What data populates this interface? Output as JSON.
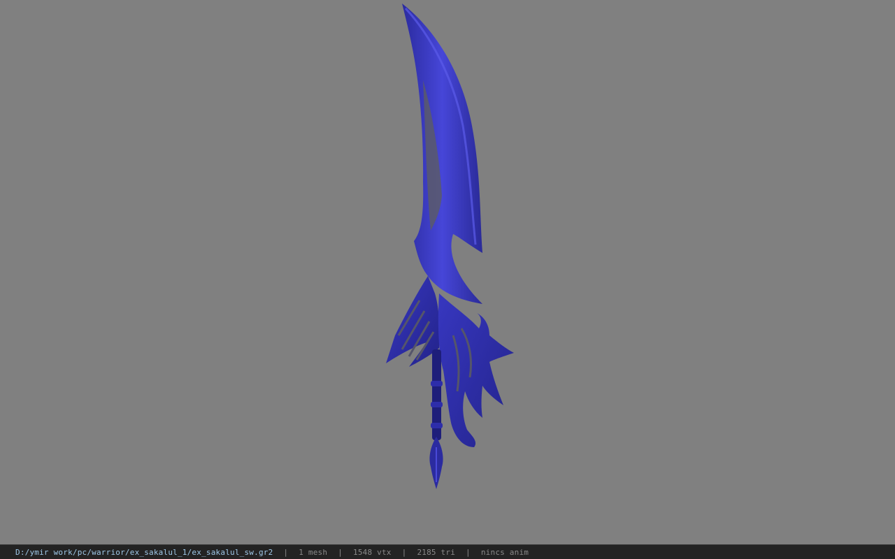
{
  "viewer": {
    "background_color": "#808080",
    "model_color": "#3c3ccf",
    "model_name": "sword-model"
  },
  "statusbar": {
    "file_path": "D:/ymir work/pc/warrior/ex_sakalul_1/ex_sakalul_sw.gr2",
    "separator": "|",
    "mesh_count": "1 mesh",
    "vertex_count": "1548 vtx",
    "triangle_count": "2185 tri",
    "animation": "nincs anim"
  }
}
